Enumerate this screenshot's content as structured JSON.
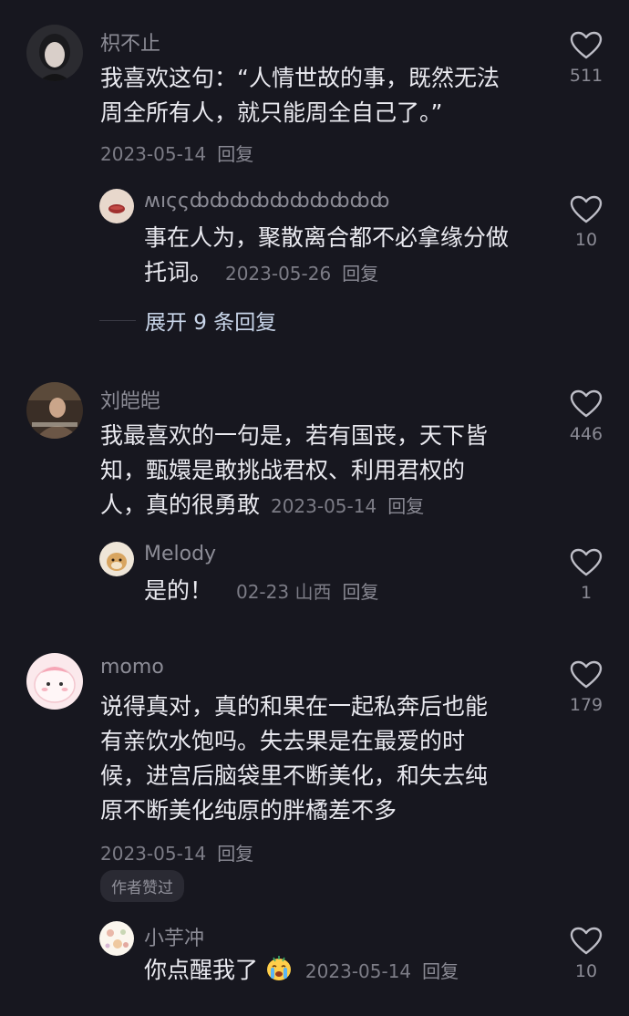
{
  "comments": [
    {
      "user": "枳不止",
      "lines": [
        "我喜欢这句：“人情世故的事，既然无法",
        "周全所有人，就只能周全自己了。”"
      ],
      "date": "2023-05-14",
      "reply": "回复",
      "likes": "511",
      "sub": [
        {
          "user": "ʍıςςȸȸȸȸȸȸȸȸȸȸ",
          "lines": [
            "事在人为，聚散离合都不必拿缘分做",
            "托词。"
          ],
          "date": "2023-05-26",
          "reply": "回复",
          "likes": "10"
        }
      ],
      "expand": "展开 9 条回复"
    },
    {
      "user": "刘皑皑",
      "lines": [
        "我最喜欢的一句是，若有国丧，天下皆",
        "知，甄嬛是敢挑战君权、利用君权的",
        "人，真的很勇敢"
      ],
      "date": "2023-05-14",
      "reply": "回复",
      "likes": "446",
      "sub": [
        {
          "user": "Melody",
          "lines": [
            "是的！"
          ],
          "date": "02-23 山西",
          "reply": "回复",
          "likes": "1"
        }
      ]
    },
    {
      "user": "momo",
      "lines": [
        "说得真对，真的和果在一起私奔后也能",
        "有亲饮水饱吗。失去果是在最爱的时",
        "候，进宫后脑袋里不断美化，和失去纯",
        "原不断美化纯原的胖橘差不多"
      ],
      "date": "2023-05-14",
      "reply": "回复",
      "likes": "179",
      "badge": "作者赞过",
      "sub": [
        {
          "user": "小芋冲",
          "lines": [
            "你点醒我了"
          ],
          "emoji": "crying-face",
          "date": "2023-05-14",
          "reply": "回复",
          "likes": "10"
        }
      ]
    }
  ]
}
